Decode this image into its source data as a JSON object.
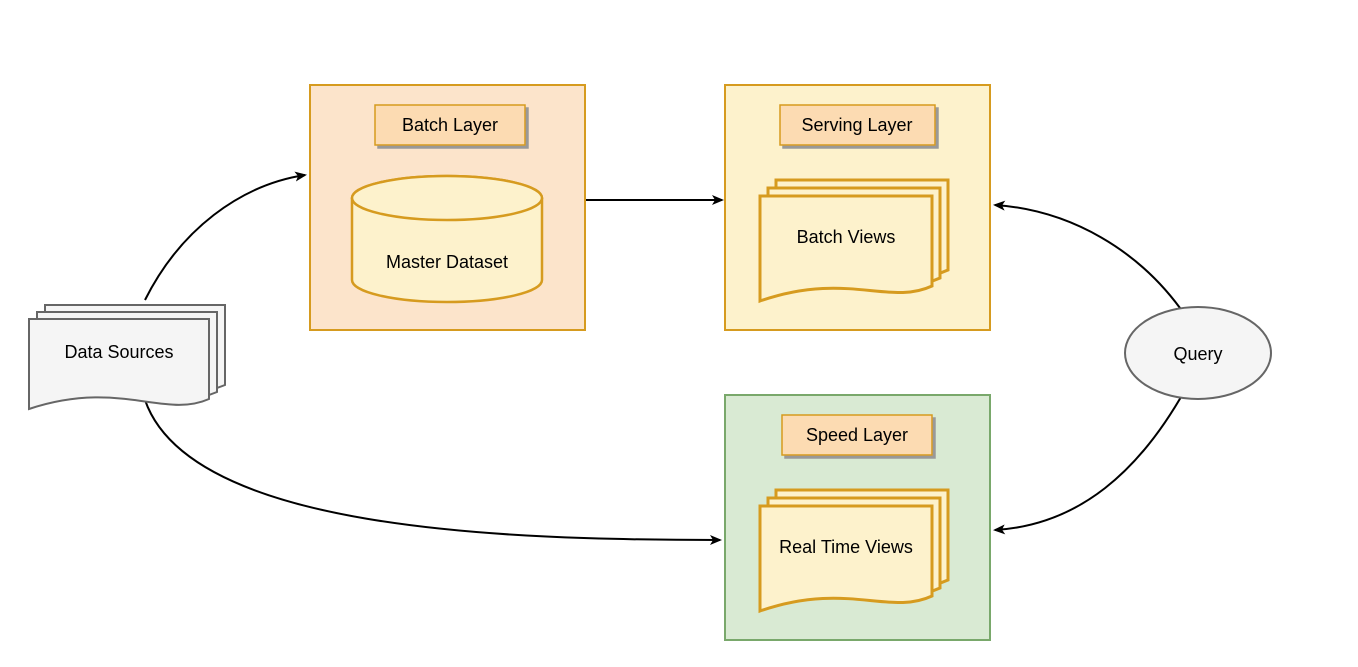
{
  "dataSources": {
    "label": "Data Sources"
  },
  "batchLayer": {
    "title": "Batch Layer",
    "dataset": "Master Dataset"
  },
  "servingLayer": {
    "title": "Serving Layer",
    "views": "Batch Views"
  },
  "speedLayer": {
    "title": "Speed Layer",
    "views": "Real Time Views"
  },
  "query": {
    "label": "Query"
  },
  "colors": {
    "batchFill": "#fce4cb",
    "batchStroke": "#d69b1f",
    "servingFill": "#fdf2cc",
    "servingStroke": "#d69b1f",
    "speedFill": "#d9ead3",
    "speedStroke": "#79a86b",
    "labelFill": "#fcdbb2",
    "labelStroke": "#d69b1f",
    "cylinderFill": "#fdf2cc",
    "cylinderStroke": "#d69b1f",
    "docFill": "#fdf2cc",
    "docStroke": "#d69b1f",
    "gray": "#666666",
    "lightGray": "#f5f5f5"
  }
}
